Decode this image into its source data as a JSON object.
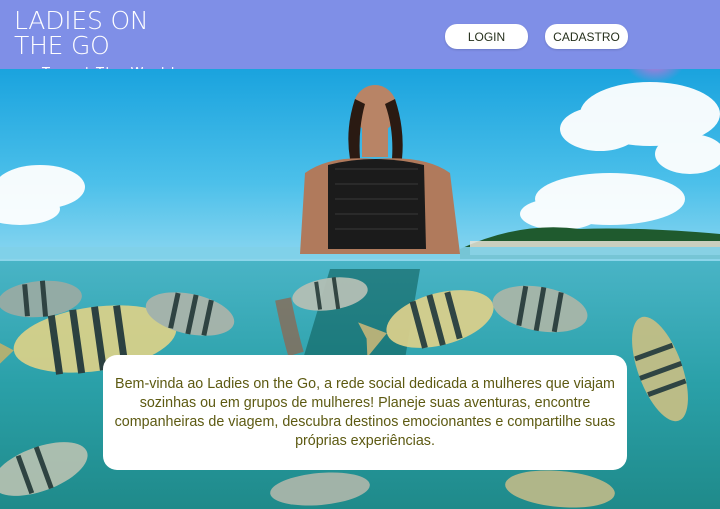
{
  "header": {
    "logo_title": "LADIES ON THE GO",
    "logo_tagline": "Travel The World",
    "login_label": "LOGIN",
    "signup_label": "CADASTRO"
  },
  "hero": {
    "welcome_text": "Bem-vinda ao Ladies on the Go, a rede social dedicada a mulheres que viajam sozinhas ou em grupos de mulheres! Planeje suas aventuras, encontre companheiras de viagem, descubra destinos emocionantes e compartilhe suas próprias experiências."
  },
  "colors": {
    "header_bg": "#7f8fe7",
    "text_olive": "#5d5a12"
  }
}
